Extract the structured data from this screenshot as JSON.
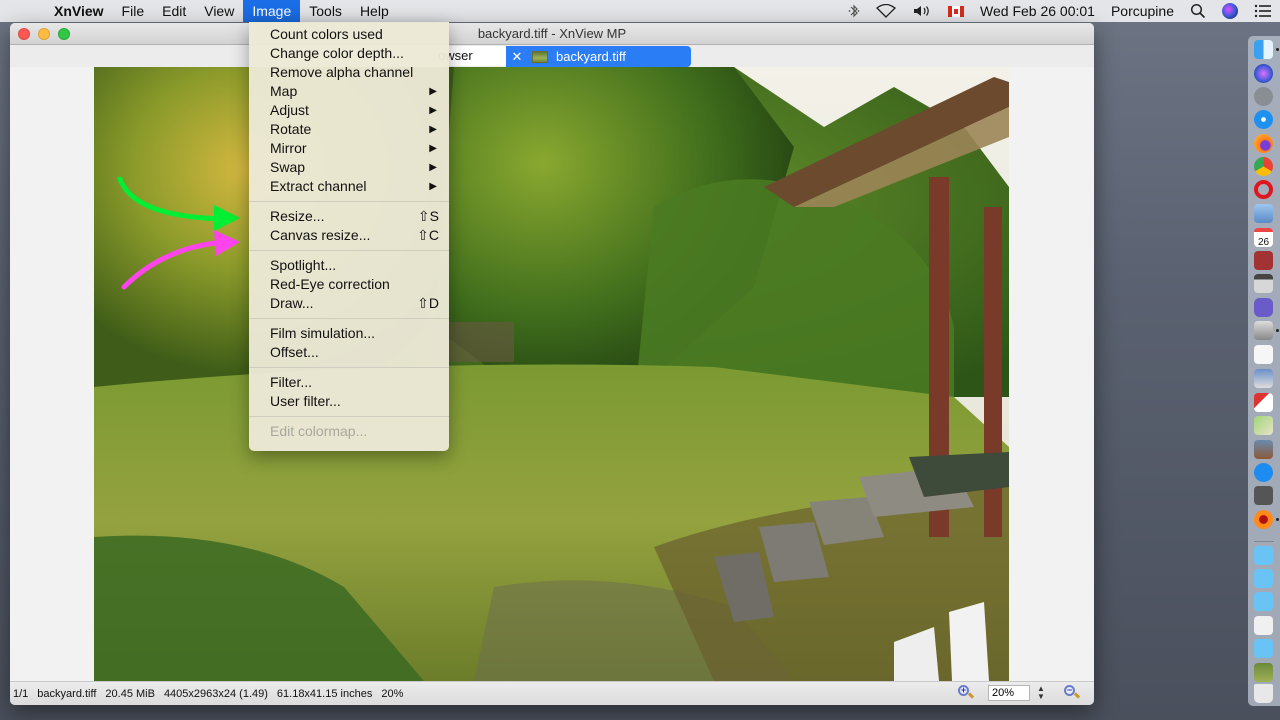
{
  "menubar": {
    "app_name": "XnView",
    "items": [
      "File",
      "Edit",
      "View",
      "Image",
      "Tools",
      "Help"
    ],
    "active_item": "Image",
    "status": {
      "datetime": "Wed Feb 26  00:01",
      "user": "Porcupine"
    }
  },
  "window": {
    "title": "backyard.tiff - XnView MP",
    "tabs": [
      {
        "label": "owser",
        "active": false
      },
      {
        "label": "backyard.tiff",
        "active": true,
        "close_glyph": "✕"
      }
    ]
  },
  "image_menu": {
    "groups": [
      [
        {
          "label": "Count colors used"
        },
        {
          "label": "Change color depth..."
        },
        {
          "label": "Remove alpha channel"
        },
        {
          "label": "Map",
          "submenu": true
        },
        {
          "label": "Adjust",
          "submenu": true
        },
        {
          "label": "Rotate",
          "submenu": true
        },
        {
          "label": "Mirror",
          "submenu": true
        },
        {
          "label": "Swap",
          "submenu": true
        },
        {
          "label": "Extract channel",
          "submenu": true
        }
      ],
      [
        {
          "label": "Resize...",
          "shortcut": "⇧S"
        },
        {
          "label": "Canvas resize...",
          "shortcut": "⇧C"
        }
      ],
      [
        {
          "label": "Spotlight..."
        },
        {
          "label": "Red-Eye correction"
        },
        {
          "label": "Draw...",
          "shortcut": "⇧D"
        }
      ],
      [
        {
          "label": "Film simulation..."
        },
        {
          "label": "Offset..."
        }
      ],
      [
        {
          "label": "Filter..."
        },
        {
          "label": "User filter..."
        }
      ],
      [
        {
          "label": "Edit colormap...",
          "disabled": true
        }
      ]
    ],
    "submenu_glyph": "▶"
  },
  "annotations": {
    "arrows": [
      {
        "color": "#00ee33",
        "points_to": "Resize..."
      },
      {
        "color": "#ff44ee",
        "points_to": "Canvas resize..."
      }
    ]
  },
  "statusbar": {
    "page": "1/1",
    "filename": "backyard.tiff",
    "filesize": "20.45 MiB",
    "dimensions": "4405x2963x24 (1.49)",
    "print_size": "61.18x41.15 inches",
    "zoom": "20%",
    "zoom_field_value": "20%"
  },
  "dock": {
    "apps": [
      "Finder",
      "Siri",
      "Launchpad",
      "Safari",
      "Firefox",
      "Chrome",
      "Opera",
      "Preview",
      "Calendar",
      "Dictionary",
      "Calculator",
      "BBEdit",
      "Keynote",
      "TextEdit",
      "Image Capture",
      "Photo Booth",
      "Maps",
      "Photos",
      "App Store",
      "System Preferences",
      "XnView MP"
    ],
    "calendar_day": "26",
    "folders": [
      "Applications",
      "Documents",
      "Downloads",
      "Desktop",
      "Folder",
      "Pictures",
      "Trash"
    ]
  }
}
